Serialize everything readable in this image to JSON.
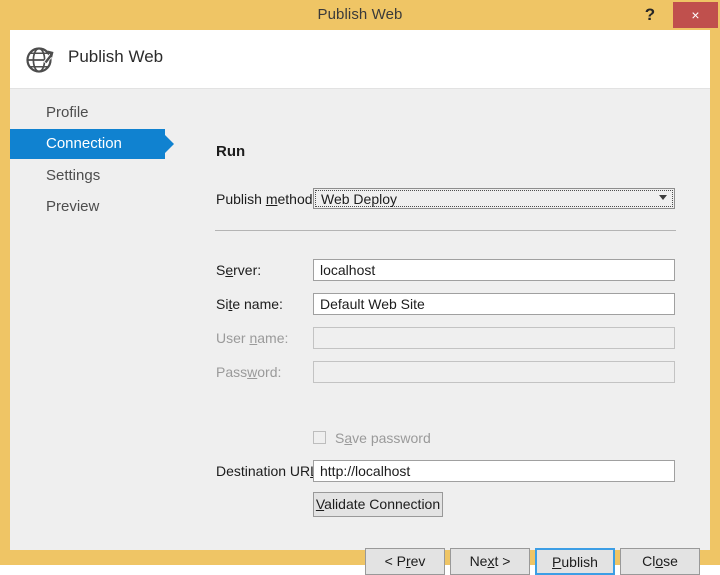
{
  "window": {
    "title": "Publish Web",
    "help_label": "?",
    "close_label": "×",
    "accent_title_bar": "#efc565",
    "accent_close": "#c0504d",
    "accent_selected": "#1082d0",
    "accent_default_button": "#3c9ee5"
  },
  "header": {
    "title": "Publish Web",
    "icon": "globe-publish-icon"
  },
  "sidebar": {
    "items": [
      {
        "label": "Profile",
        "selected": false
      },
      {
        "label": "Connection",
        "selected": true
      },
      {
        "label": "Settings",
        "selected": false
      },
      {
        "label": "Preview",
        "selected": false
      }
    ]
  },
  "main": {
    "section_title": "Run",
    "publish_method": {
      "label_before": "Publish ",
      "label_key": "m",
      "label_after": "ethod:",
      "value": "Web Deploy",
      "options": [
        "Web Deploy"
      ],
      "focused": true
    },
    "fields": [
      {
        "name": "server",
        "label_before": "S",
        "label_key": "e",
        "label_after": "rver:",
        "value": "localhost",
        "placeholder": "",
        "disabled": false
      },
      {
        "name": "site-name",
        "label_before": "Si",
        "label_key": "t",
        "label_after": "e name:",
        "value": "Default Web Site",
        "placeholder": "",
        "disabled": false
      },
      {
        "name": "user-name",
        "label_before": "User ",
        "label_key": "n",
        "label_after": "ame:",
        "value": "",
        "placeholder": "",
        "disabled": true
      },
      {
        "name": "password",
        "label_before": "Pass",
        "label_key": "w",
        "label_after": "ord:",
        "value": "",
        "placeholder": "",
        "disabled": true
      }
    ],
    "save_password": {
      "label_before": "S",
      "label_key": "a",
      "label_after": "ve password",
      "checked": false,
      "disabled": true
    },
    "destination_url": {
      "label_before": "Destination UR",
      "label_key": "L",
      "label_after": ":",
      "value": "http://localhost",
      "placeholder": "",
      "disabled": false
    },
    "validate_button": {
      "label_before": "",
      "label_key": "V",
      "label_after": "alidate Connection"
    }
  },
  "footer": {
    "buttons": [
      {
        "name": "prev",
        "label_before": "< P",
        "label_key": "r",
        "label_after": "ev",
        "default": false
      },
      {
        "name": "next",
        "label_before": "Ne",
        "label_key": "x",
        "label_after": "t >",
        "default": false
      },
      {
        "name": "publish",
        "label_before": "",
        "label_key": "P",
        "label_after": "ublish",
        "default": true
      },
      {
        "name": "close",
        "label_before": "Cl",
        "label_key": "o",
        "label_after": "se",
        "default": false
      }
    ]
  }
}
